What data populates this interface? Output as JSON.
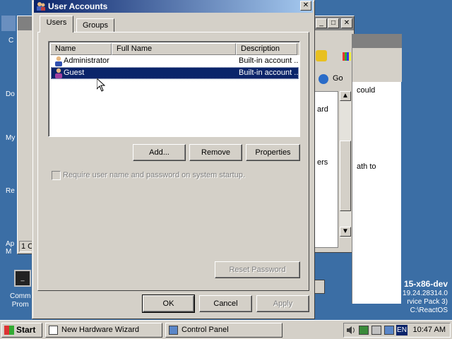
{
  "colors": {
    "desktop": "#3b6ea5",
    "titlebar_start": "#0a246a",
    "titlebar_end": "#a6caf0",
    "selection": "#0a246a",
    "face": "#d4d0c8"
  },
  "desktop": {
    "icon_labels": [
      "C",
      "Do",
      "My",
      "Re",
      "Ap\nM",
      "Comm\nProm"
    ],
    "info_lines": [
      "15-x86-dev",
      "19.24.28314.0",
      "rvice Pack 3)",
      "C:\\ReactOS"
    ]
  },
  "bg_window": {
    "go_label": "Go",
    "text_lines": [
      "could",
      "ard",
      "ers",
      "ath to"
    ],
    "status": "1 O"
  },
  "dialog": {
    "title": "User Accounts",
    "tabs": [
      {
        "label": "Users"
      },
      {
        "label": "Groups"
      }
    ],
    "list": {
      "columns": [
        "Name",
        "Full Name",
        "Description"
      ],
      "rows": [
        {
          "name": "Administrator",
          "full_name": "",
          "description": "Built-in account ..."
        },
        {
          "name": "Guest",
          "full_name": "",
          "description": "Built-in account ...",
          "selected": true
        }
      ]
    },
    "buttons": {
      "add": "Add...",
      "remove": "Remove",
      "properties": "Properties",
      "reset_password": "Reset Password"
    },
    "require_login_label": "Require user name and password on system startup.",
    "footer": {
      "ok": "OK",
      "cancel": "Cancel",
      "apply": "Apply"
    }
  },
  "taskbar": {
    "start": "Start",
    "tasks": [
      {
        "label": "New Hardware Wizard"
      },
      {
        "label": "Control Panel"
      }
    ],
    "language": "EN",
    "clock": "10:47 AM"
  }
}
